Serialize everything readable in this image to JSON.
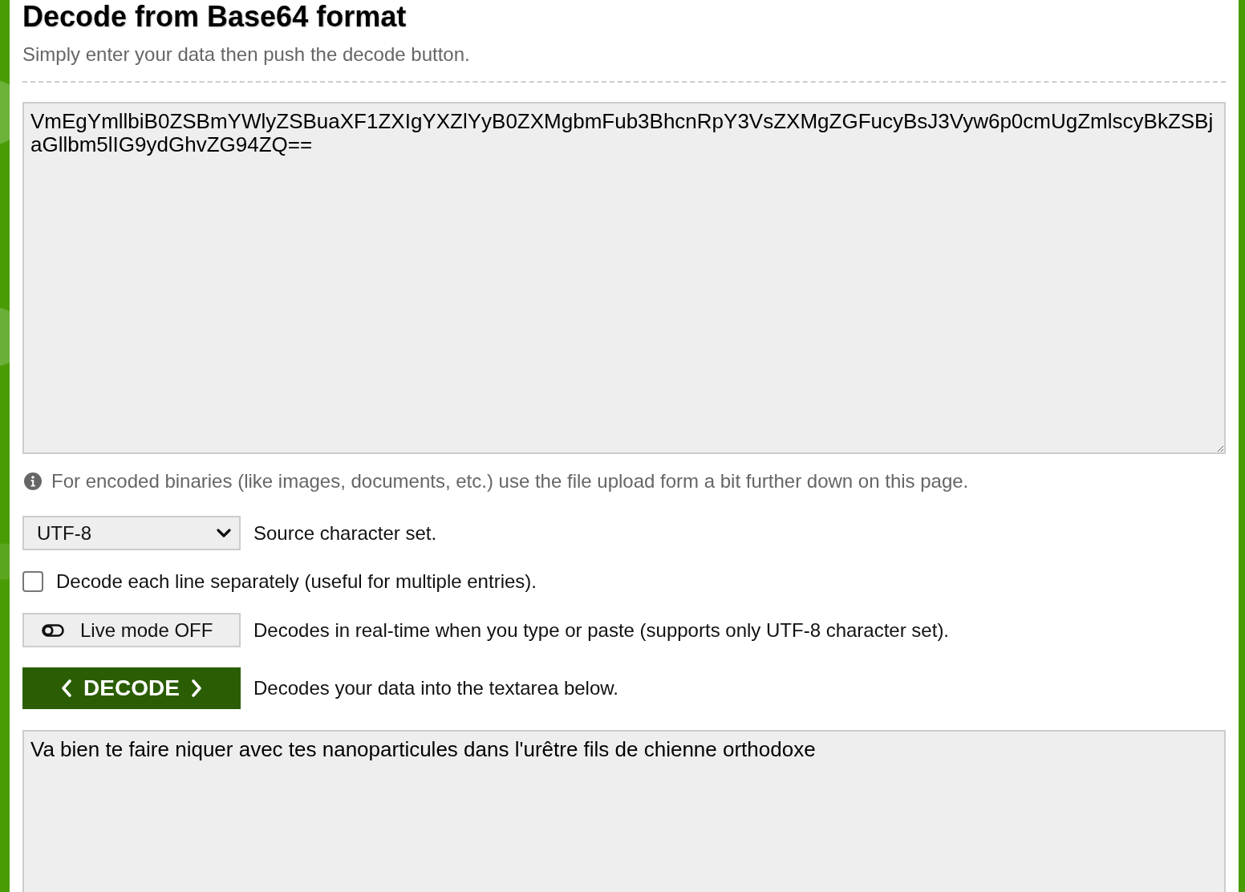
{
  "heading": {
    "title": "Decode from Base64 format",
    "subtitle": "Simply enter your data then push the decode button."
  },
  "input": {
    "value": "VmEgYmllbiB0ZSBmYWlyZSBuaXF1ZXIgYXZlYyB0ZXMgbmFub3BhcnRpY3VsZXMgZGFucyBsJ3Vyw6p0cmUgZmlscyBkZSBjaGllbm5lIG9ydGhvZG94ZQ=="
  },
  "info_note": "For encoded binaries (like images, documents, etc.) use the file upload form a bit further down on this page.",
  "options": [
    {
      "kind": "select",
      "value": "UTF-8",
      "description": "Source character set."
    },
    {
      "kind": "checkbox",
      "label": "Decode each line separately (useful for multiple entries).",
      "checked": false
    },
    {
      "kind": "toggle",
      "label": "Live mode OFF",
      "on": false,
      "description": "Decodes in real-time when you type or paste (supports only UTF-8 character set)."
    },
    {
      "kind": "action",
      "label": "DECODE",
      "description": "Decodes your data into the textarea below."
    }
  ],
  "output": {
    "value": "Va bien te faire niquer avec tes nanoparticules dans l'urêtre fils de chienne orthodoxe"
  }
}
